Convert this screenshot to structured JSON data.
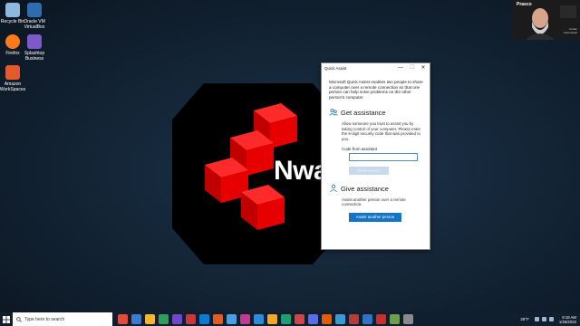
{
  "desktop": {
    "icons": [
      {
        "label": "Recycle Bin",
        "color": "#8fb8de"
      },
      {
        "label": "Oracle VM VirtualBox",
        "color": "#2f6db3"
      },
      {
        "label": "Firefox",
        "color": "#ff7a1a"
      },
      {
        "label": "Splashtop Business",
        "color": "#7d59c9"
      },
      {
        "label": "Amazon WorkSpaces",
        "color": "#e35b2d"
      }
    ],
    "brand_text": "Nwa"
  },
  "webcam": {
    "name": "Prasco",
    "sub_line1": "Jordan",
    "sub_line2": "Carmichael"
  },
  "quick_assist": {
    "title": "Quick Assist",
    "controls": {
      "minimize": "—",
      "maximize": "☐",
      "close": "✕"
    },
    "intro": "Microsoft Quick Assist enables two people to share a computer over a remote connection so that one person can help solve problems on the other person's computer.",
    "get_assistance": {
      "heading": "Get assistance",
      "description": "Allow someone you trust to assist you by taking control of your computer. Please enter the 6-digit security code that was provided to you.",
      "code_label": "Code from assistant",
      "code_value": "",
      "share_button": "Share screen"
    },
    "give_assistance": {
      "heading": "Give assistance",
      "description": "Assist another person over a remote connection.",
      "assist_button": "Assist another person"
    }
  },
  "taskbar": {
    "search_placeholder": "Type here to search",
    "apps": [
      "#e24c3a",
      "#3a7bd5",
      "#f2b632",
      "#2e9e58",
      "#6f47c8",
      "#d13438",
      "#0f78d4",
      "#e85a1c",
      "#4b9fe0",
      "#c43a8f",
      "#2c8cd8",
      "#f5a623",
      "#1f9e6f",
      "#d04545",
      "#5b6ee1",
      "#e65c00",
      "#3d9ad1",
      "#b83a3a",
      "#2f74c0",
      "#c9302c",
      "#6ca04c",
      "#8a8a8a"
    ],
    "weather": "28°F",
    "time": "9:18 AM",
    "date": "1/26/2022"
  }
}
